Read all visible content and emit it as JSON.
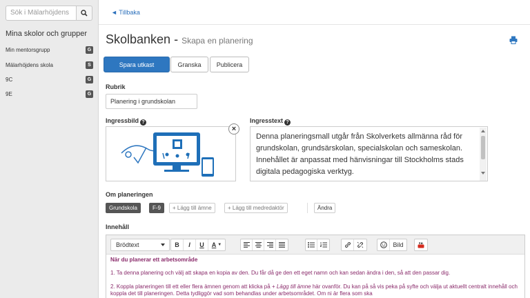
{
  "sidebar": {
    "search_placeholder": "Sök i Mälarhöjdens",
    "heading": "Mina skolor och grupper",
    "items": [
      {
        "label": "Min mentorsgrupp",
        "badge": "G"
      },
      {
        "label": "Mälarhöjdens skola",
        "badge": "S"
      },
      {
        "label": "9C",
        "badge": "G"
      },
      {
        "label": "9E",
        "badge": "G"
      }
    ]
  },
  "topbar": {
    "back_label": "◄ Tillbaka"
  },
  "page": {
    "title": "Skolbanken",
    "separator": " - ",
    "subtitle": "Skapa en planering"
  },
  "actions": {
    "save_draft": "Spara utkast",
    "review": "Granska",
    "publish": "Publicera"
  },
  "form": {
    "title_label": "Rubrik",
    "title_value": "Planering i grundskolan",
    "image_label": "Ingressbild",
    "intro_label": "Ingresstext",
    "intro_value": "Denna planeringsmall utgår från Skolverkets allmänna råd för grundskolan, grundsärskolan, specialskolan och sameskolan. Innehållet är anpassat med hänvisningar till Stockholms stads digitala pedagogiska verktyg.",
    "about_label": "Om planeringen",
    "tags": [
      "Grundskola",
      "F-9"
    ],
    "add_subject": "+ Lägg till ämne",
    "add_coauthor": "+ Lägg till medredaktör",
    "change": "Ändra",
    "content_label": "Innehåll"
  },
  "editor": {
    "format_value": "Brödtext",
    "image_button": "Bild",
    "heading": "När du planerar ett arbetsområde",
    "p1": "1. Ta denna planering och välj att skapa en kopia av den. Du får då ge den ett eget namn och kan sedan ändra i den, så att den passar dig.",
    "p2_before": "2. Koppla planeringen till ett eller flera ämnen genom att klicka på ",
    "p2_link": "+ Lägg till ämne",
    "p2_after": " här ovanför. Du kan på så vis peka på syfte och välja ut aktuellt centralt innehåll och koppla det till planeringen. Detta tydliggör vad som behandlas under arbetsområdet. Om ni är flera som ska"
  },
  "colors": {
    "primary": "#2e77c0",
    "link": "#2a6fbb",
    "content_text": "#8a2b6b",
    "sidebar_bg": "#ebebeb"
  }
}
